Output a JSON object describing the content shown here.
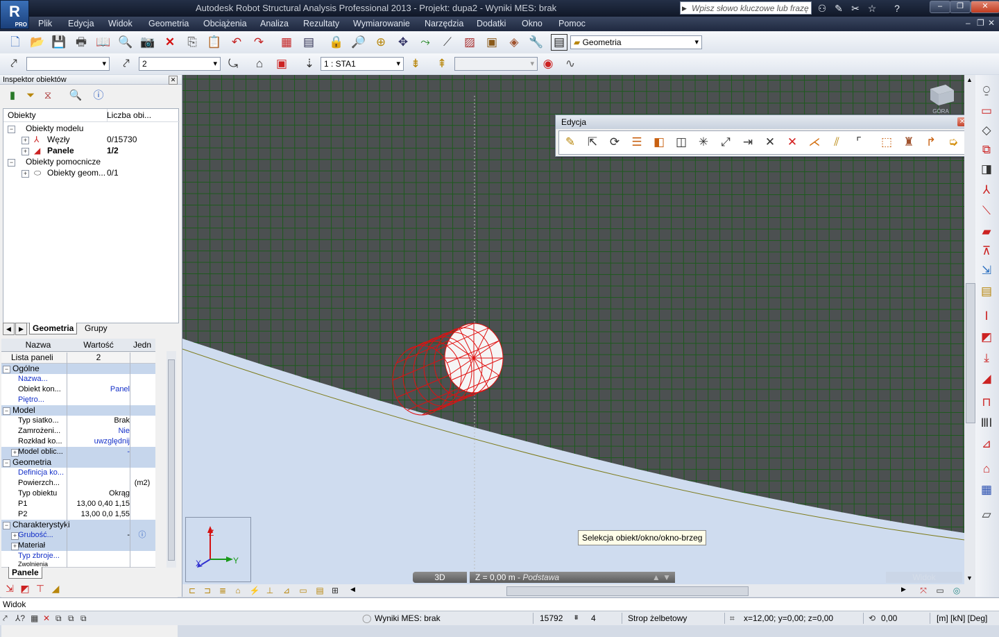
{
  "window": {
    "title": "Autodesk Robot Structural Analysis Professional 2013 - Projekt: dupa2 - Wyniki MES: brak",
    "logo_text": "R",
    "logo_sub": "PRO"
  },
  "search": {
    "placeholder": "Wpisz słowo kluczowe lub frazę"
  },
  "menu": [
    "Plik",
    "Edycja",
    "Widok",
    "Geometria",
    "Obciążenia",
    "Analiza",
    "Rezultaty",
    "Wymiarowanie",
    "Narzędzia",
    "Dodatki",
    "Okno",
    "Pomoc"
  ],
  "toolbar": {
    "layout_combo": "Geometria",
    "selection_value": "2",
    "case_combo": "1 : STA1"
  },
  "inspector": {
    "title": "Inspektor obiektów",
    "tree_headers": [
      "Obiekty",
      "Liczba obi..."
    ],
    "tree": [
      {
        "label": "Obiekty modelu",
        "count": ""
      },
      {
        "label": "Węzły",
        "count": "0/15730"
      },
      {
        "label": "Panele",
        "count": "1/2"
      },
      {
        "label": "Obiekty pomocnicze",
        "count": ""
      },
      {
        "label": "Obiekty geom...",
        "count": "0/1"
      }
    ],
    "tabs": [
      "Geometria",
      "Grupy"
    ],
    "prop_headers": [
      "Nazwa",
      "Wartość",
      "Jedn"
    ],
    "list_label": "Lista paneli",
    "list_value": "2",
    "groups": {
      "general": "Ogólne",
      "model": "Model",
      "geometry": "Geometria",
      "characteristics": "Charakterystyki"
    },
    "props_general": [
      {
        "name": "Nazwa...",
        "value": "",
        "unit": ""
      },
      {
        "name": "Obiekt kon...",
        "value": "Panel",
        "unit": ""
      },
      {
        "name": "Piętro...",
        "value": "",
        "unit": ""
      }
    ],
    "props_model": [
      {
        "name": "Typ siatko...",
        "value": "Brak",
        "unit": ""
      },
      {
        "name": "Zamrożeni...",
        "value": "Nie",
        "unit": ""
      },
      {
        "name": "Rozkład ko...",
        "value": "uwzględnij",
        "unit": ""
      },
      {
        "name": "Model oblic...",
        "value": "-",
        "unit": ""
      }
    ],
    "props_geometry": [
      {
        "name": "Definicja ko...",
        "value": "",
        "unit": ""
      },
      {
        "name": "Powierzch...",
        "value": "",
        "unit": "(m2)"
      },
      {
        "name": "Typ obiektu",
        "value": "Okrąg",
        "unit": ""
      },
      {
        "name": "P1",
        "value": "13,00 0,40 1,15",
        "unit": ""
      },
      {
        "name": "P2",
        "value": "13,00 0,0 1,55",
        "unit": ""
      }
    ],
    "props_char": [
      {
        "name": "Grubość...",
        "value": "-",
        "unit": ""
      },
      {
        "name": "Materiał",
        "value": "",
        "unit": ""
      },
      {
        "name": "Typ zbroje...",
        "value": "",
        "unit": ""
      },
      {
        "name": "Zwolnienia",
        "value": "",
        "unit": ""
      }
    ],
    "bottom_tab": "Panele"
  },
  "edycja": {
    "title": "Edycja"
  },
  "viewport": {
    "tooltip": "Selekcja obiekt/okno/okno-brzeg",
    "view_mode": "3D",
    "plane_label": "Z = 0,00 m",
    "plane_name": "Podstawa",
    "watermark": "Widok",
    "axis_x": "X",
    "axis_y": "Y",
    "axis_z": "Z",
    "viewcube_label": "GÓRA"
  },
  "command_line": "Widok",
  "status": {
    "results": "Wyniki MES: brak",
    "nodes": "15792",
    "count": "4",
    "section": "Strop żelbetowy",
    "coords": "x=12,00; y=0,00; z=0,00",
    "angle": "0,00",
    "units": "[m] [kN] [Deg]"
  },
  "colors": {
    "mesh_bg": "#4c5051",
    "mesh_line": "#1e5a1e",
    "selection": "#e01010",
    "sky": "#cfdcef"
  }
}
